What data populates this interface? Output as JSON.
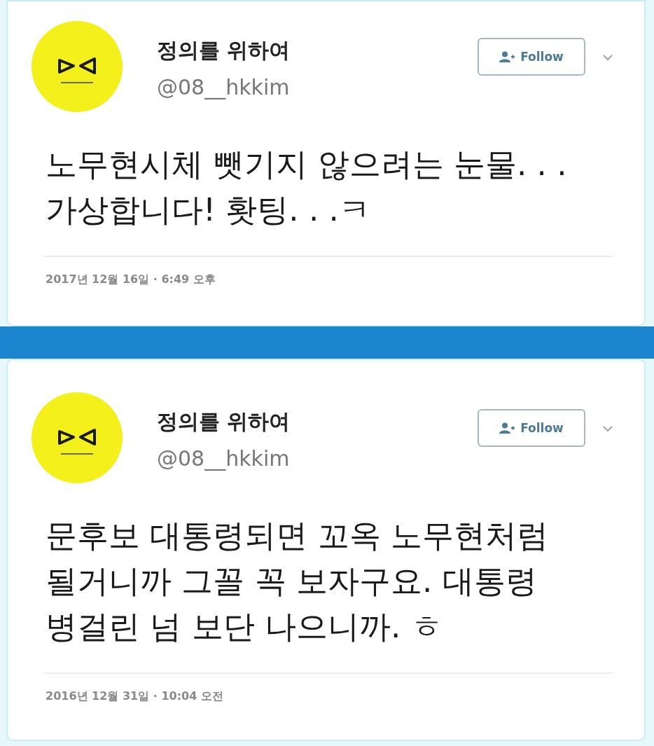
{
  "tweets": [
    {
      "display_name": "정의를 위하여",
      "handle": "@08__hkkim",
      "follow_button": "Follow",
      "text": "노무현시체 뺏기지 않으려는 눈물. . .\n가상합니다! 홧팅. . .ㅋ",
      "timestamp": "2017년 12월 16일 · 6:49 오후"
    },
    {
      "display_name": "정의를 위하여",
      "handle": "@08__hkkim",
      "follow_button": "Follow",
      "text": "문후보 대통령되면 꼬옥 노무현처럼\n될거니까 그꼴 꼭 보자구요. 대통령\n병걸린 넘 보단 나으니까. ㅎ",
      "timestamp": "2016년 12월 31일 · 10:04 오전"
    }
  ]
}
